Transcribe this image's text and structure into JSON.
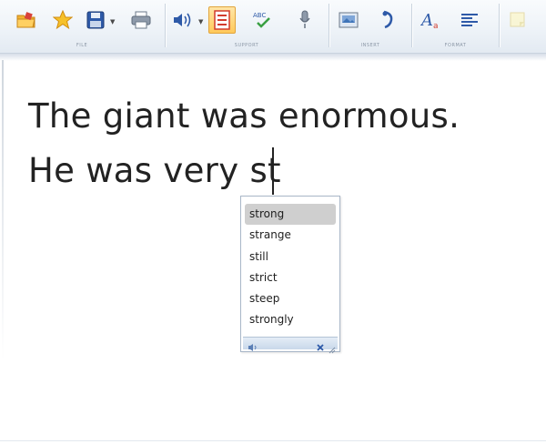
{
  "toolbar": {
    "groups": [
      {
        "label": "FILE"
      },
      {
        "label": "SUPPORT"
      },
      {
        "label": "INSERT"
      },
      {
        "label": "FORMAT"
      }
    ],
    "icons": [
      "open-folder-icon",
      "favourite-star-icon",
      "save-disk-icon",
      "print-icon",
      "speech-volume-icon",
      "word-prediction-list-icon",
      "spell-check-icon",
      "microphone-icon",
      "insert-picture-icon",
      "insert-symbol-icon",
      "font-style-icon",
      "align-left-icon",
      "note-icon"
    ],
    "active_tool": "word-prediction-list-icon"
  },
  "document": {
    "lines": [
      "The giant was enormous.",
      "He was very st"
    ]
  },
  "prediction": {
    "items": [
      "strong",
      "strange",
      "still",
      "strict",
      "steep",
      "strongly"
    ],
    "selected_index": 0
  },
  "colors": {
    "ribbon_top": "#f9fbfd",
    "ribbon_bottom": "#e3eaf2",
    "active_tool": "#ffc95a",
    "selection": "#cfcfcf",
    "popup_border": "#a9b7c8",
    "text": "#222222"
  }
}
